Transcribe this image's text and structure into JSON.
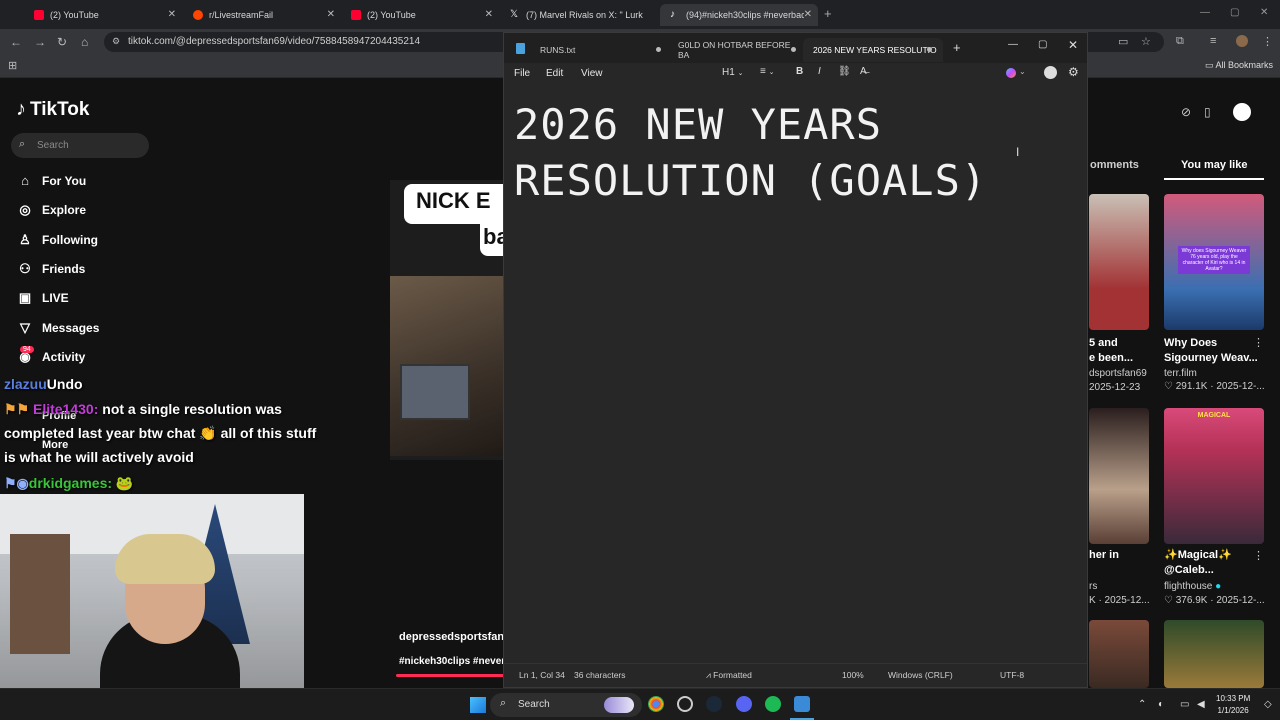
{
  "browser": {
    "tabs": [
      {
        "title": "(2) YouTube",
        "icon": "youtube-icon",
        "color": "#ff0033"
      },
      {
        "title": "r/LivestreamFail",
        "icon": "reddit-icon",
        "color": "#ff4500"
      },
      {
        "title": "(2) YouTube",
        "icon": "youtube-icon",
        "color": "#ff0033"
      },
      {
        "title": "(7) Marvel Rivals on X: \" Lurk",
        "icon": "x-icon",
        "color": "#e7e7e7"
      },
      {
        "title": "(94)#nickeh30clips #neverback",
        "icon": "tiktok-icon",
        "color": "#ffffff"
      }
    ],
    "url": "tiktok.com/@depressedsportsfan69/video/7588458947204435214",
    "all_bookmarks": "All Bookmarks"
  },
  "tiktok": {
    "logo": "TikTok",
    "search_placeholder": "Search",
    "nav": [
      {
        "label": "For You",
        "icon": "home-icon",
        "glyph": "⌂"
      },
      {
        "label": "Explore",
        "icon": "compass-icon",
        "glyph": "◎"
      },
      {
        "label": "Following",
        "icon": "following-icon",
        "glyph": "♙"
      },
      {
        "label": "Friends",
        "icon": "friends-icon",
        "glyph": "⚇"
      },
      {
        "label": "LIVE",
        "icon": "live-icon",
        "glyph": "▣"
      },
      {
        "label": "Messages",
        "icon": "messages-icon",
        "glyph": "▽"
      },
      {
        "label": "Activity",
        "icon": "activity-icon",
        "glyph": "◉"
      }
    ],
    "activity_badge": "94",
    "profile_label": "Profile",
    "more_label": "More",
    "video": {
      "caption_line1": "NICK E",
      "caption_line2": "ba",
      "author": "depressedsportsfan",
      "tags": "#nickeh30clips #never"
    },
    "right": {
      "tab_comments": "omments",
      "tab_you_may_like": "You may like",
      "cards": [
        {
          "title_l1": "5 and",
          "title_l2": "e been...",
          "author": "dsportsfan69",
          "date": "2025-12-23"
        },
        {
          "title_l1": "Why Does",
          "title_l2": "Sigourney Weav...",
          "author": "terr.film",
          "stats": "♡ 291.1K · 2025-12-..."
        },
        {
          "title_l1": "her in",
          "author": "rs",
          "stats": "K · 2025-12..."
        },
        {
          "title_l1": "✨Magical✨",
          "title_l2": "@Caleb...",
          "author": "flighthouse",
          "stats": "♡ 376.9K · 2025-12-..."
        }
      ],
      "card2_overlay": "Why does Sigourney Weaver 76 years old, play the character of Kiri who is 14 in Avatar?",
      "card4_overlay": "MAGICAL"
    }
  },
  "chat": [
    {
      "user": "zlazuu",
      "text": "Undo",
      "user_color": "#5a7ee0"
    },
    {
      "user": "Elite1430:",
      "text": " not a single resolution was completed last year btw chat 👏 all of this stuff is what he will actively avoid",
      "user_color": "#c33cdb"
    },
    {
      "user": "drkidgames:",
      "text": " 🐸",
      "user_color": "#3ac43a"
    }
  ],
  "notepad": {
    "tabs": [
      "RUNS.txt",
      "G0LD ON HOTBAR BEFORE BA",
      "2026 NEW YEARS RESOLUTIO"
    ],
    "menu": [
      "File",
      "Edit",
      "View"
    ],
    "format": {
      "heading": "H1",
      "list": "≡",
      "bold": "B",
      "italic": "I",
      "link": "⛓",
      "clear": "A̶"
    },
    "content_line1": "2026 NEW YEARS",
    "content_line2": "RESOLUTION (GOALS)",
    "status": {
      "position": "Ln 1, Col 34",
      "chars": "36 characters",
      "formatted": "Formatted",
      "zoom": "100%",
      "eol": "Windows (CRLF)",
      "encoding": "UTF-8"
    }
  },
  "taskbar": {
    "search": "Search",
    "time": "10:33 PM",
    "date": "1/1/2026"
  }
}
